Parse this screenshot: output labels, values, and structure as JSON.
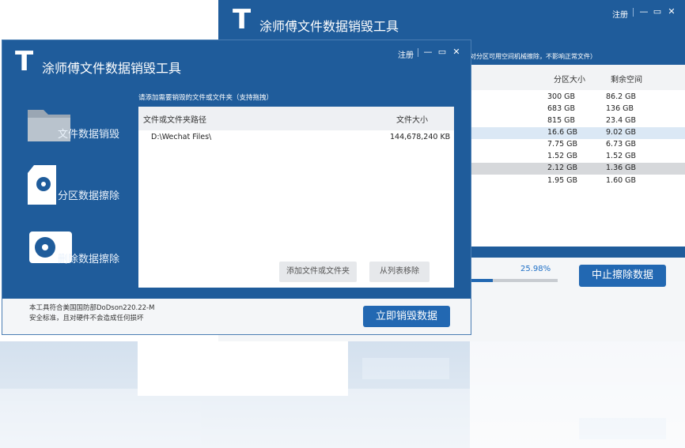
{
  "app": {
    "title": "涂师傅文件数据销毁工具",
    "logo_letter": "T",
    "register_label": "注册",
    "controls": {
      "minimize": "—",
      "maximize": "▭",
      "close": "✕"
    }
  },
  "back_window": {
    "hint": "对分区可用空间机械擦除，不影响正常文件）",
    "columns": {
      "size": "分区大小",
      "free": "剩余空间"
    },
    "rows": [
      {
        "size": "300 GB",
        "free": "86.2 GB"
      },
      {
        "size": "683 GB",
        "free": "136  GB"
      },
      {
        "size": "815 GB",
        "free": "23.4 GB"
      },
      {
        "size": "16.6 GB",
        "free": "9.02 GB"
      },
      {
        "size": "7.75 GB",
        "free": "6.73 GB"
      },
      {
        "size": "1.52 GB",
        "free": "1.52 GB"
      },
      {
        "size": "2.12 GB",
        "free": "1.36 GB"
      },
      {
        "size": "1.95 GB",
        "free": "1.60 GB"
      }
    ],
    "progress_percent": "25.98%",
    "progress_value": 0.2598,
    "stop_label": "中止擦除数据"
  },
  "front_window": {
    "sidebar": [
      {
        "label": "文件数据销毁"
      },
      {
        "label": "分区数据擦除"
      },
      {
        "label": "删除数据擦除"
      }
    ],
    "instruction": "请添加需要销毁的文件或文件夹（支持拖拽）",
    "columns": {
      "path": "文件或文件夹路径",
      "size": "文件大小"
    },
    "files": [
      {
        "path": "D:\\Wechat Files\\",
        "size": "144,678,240 KB"
      }
    ],
    "add_label": "添加文件或文件夹",
    "remove_label": "从列表移除",
    "footer_line1": "本工具符合美国国防部DoDson220.22-M",
    "footer_line2": "安全标准，且对硬件不会造成任何损坏",
    "destroy_label": "立即销毁数据"
  },
  "colors": {
    "primary": "#1f5c9b",
    "button": "#2268b2",
    "accent_text": "#1e6fc6"
  }
}
